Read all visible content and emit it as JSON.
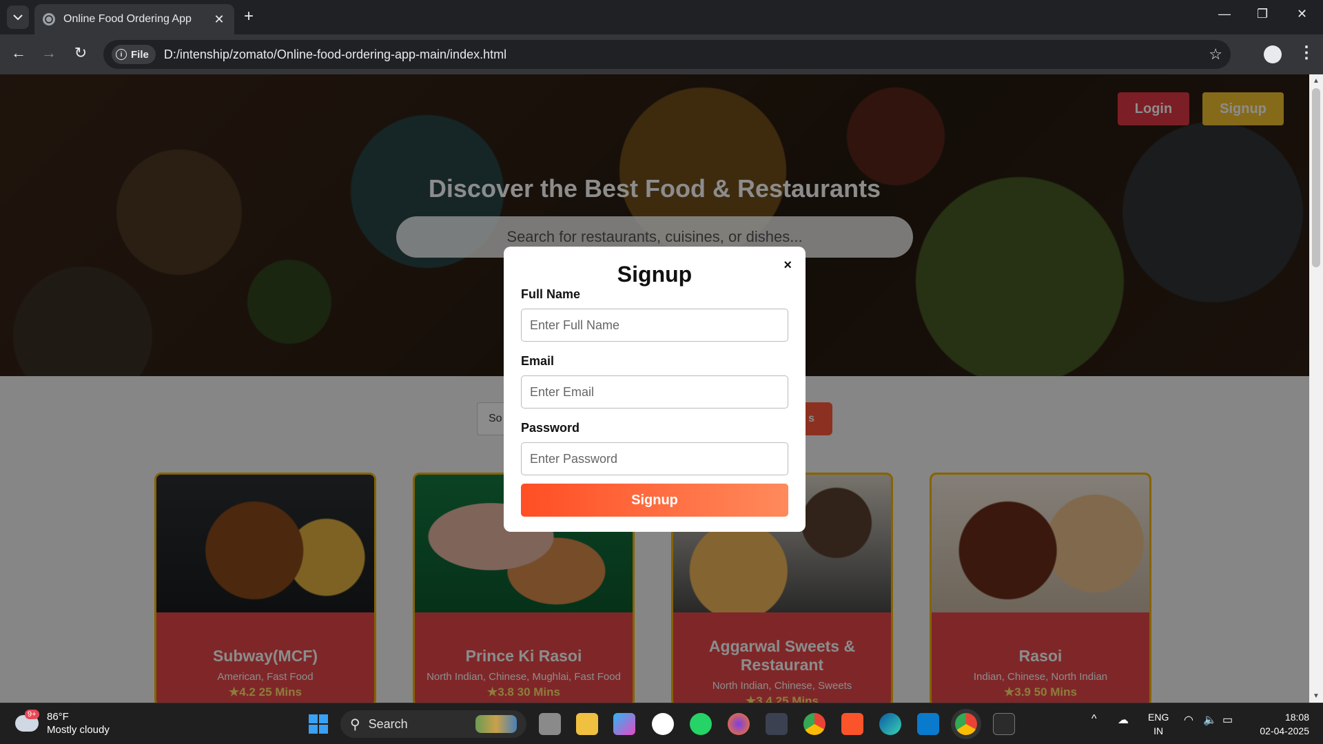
{
  "browser": {
    "tab_title": "Online Food Ordering App",
    "tab_close": "✕",
    "new_tab": "+",
    "chip_label": "File",
    "url": "D:/intenship/zomato/Online-food-ordering-app-main/index.html",
    "window_controls": [
      "—",
      "❐",
      "✕"
    ]
  },
  "page": {
    "hero_title": "Discover the Best Food & Restaurants",
    "hero_search_placeholder": "Search for restaurants, cuisines, or dishes...",
    "login_label": "Login",
    "signup_label": "Signup",
    "filter_input_partial": "So",
    "filter_button_partial": "s"
  },
  "restaurants": [
    {
      "name": "Subway(MCF)",
      "cuisine": "American, Fast Food",
      "rating": "4.2",
      "time": "25 Mins"
    },
    {
      "name": "Prince Ki Rasoi",
      "cuisine": "North Indian, Chinese, Mughlai, Fast Food",
      "rating": "3.8",
      "time": "30 Mins"
    },
    {
      "name": "Aggarwal Sweets & Restaurant",
      "cuisine": "North Indian, Chinese, Sweets",
      "rating": "3.4",
      "time": "25 Mins"
    },
    {
      "name": "Rasoi",
      "cuisine": "Indian, Chinese, North Indian",
      "rating": "3.9",
      "time": "50 Mins"
    }
  ],
  "modal": {
    "title": "Signup",
    "close": "×",
    "full_name_label": "Full Name",
    "full_name_placeholder": "Enter Full Name",
    "email_label": "Email",
    "email_placeholder": "Enter Email",
    "password_label": "Password",
    "password_placeholder": "Enter Password",
    "submit_label": "Signup"
  },
  "taskbar": {
    "weather_temp": "86°F",
    "weather_desc": "Mostly cloudy",
    "weather_badge": "9+",
    "search_label": "Search",
    "lang_1": "ENG",
    "lang_2": "IN",
    "time": "18:08",
    "date": "02-04-2025"
  },
  "colors": {
    "accent_login": "#e23744",
    "accent_signup": "#f2c230",
    "submit_gradient_start": "#ff4e24",
    "submit_gradient_end": "#ff8a5c"
  }
}
